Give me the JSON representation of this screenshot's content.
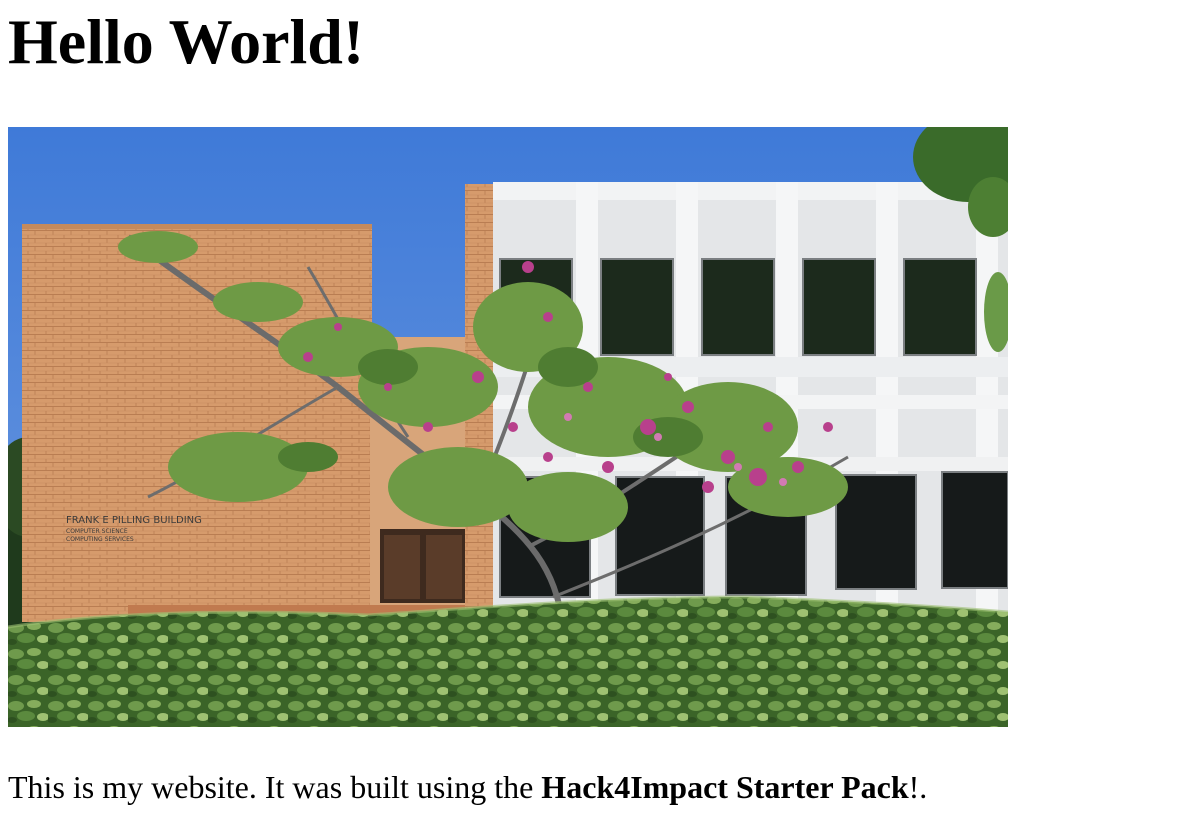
{
  "page": {
    "heading": "Hello World!",
    "caption_before": "This is my website. It was built using the ",
    "caption_bold": "Hack4Impact Starter Pack",
    "caption_after": "!."
  },
  "photo": {
    "building_sign_lines": [
      "FRANK E PILLING BUILDING",
      "COMPUTER SCIENCE",
      "COMPUTING SERVICES"
    ],
    "colors": {
      "sky": "#4f84d6",
      "brick": "#d69b6c",
      "concrete": "#e9eaeb",
      "hedge": "#3f6b2a",
      "blossom": "#b8408c"
    }
  }
}
